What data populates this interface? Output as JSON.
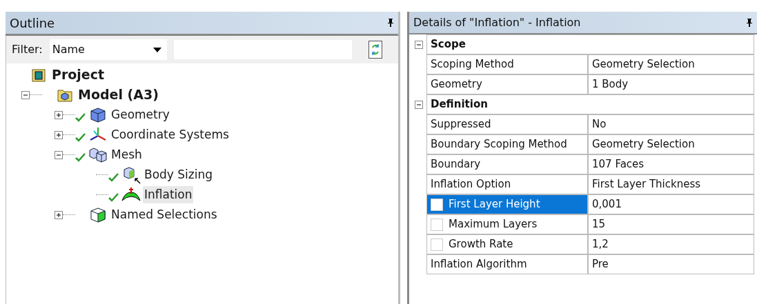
{
  "outline": {
    "title": "Outline",
    "filter": {
      "label": "Filter:",
      "value": "Name"
    },
    "tree": [
      {
        "label": "Project",
        "kind": "project",
        "children": [
          {
            "label": "Model (A3)",
            "kind": "model",
            "expanded": true,
            "children": [
              {
                "label": "Geometry",
                "kind": "geometry",
                "expanded": false,
                "solved": true,
                "selected": false
              },
              {
                "label": "Coordinate Systems",
                "kind": "axes",
                "expanded": false,
                "solved": true,
                "selected": false
              },
              {
                "label": "Mesh",
                "kind": "mesh",
                "expanded": true,
                "solved": true,
                "selected": false,
                "children": [
                  {
                    "label": "Body Sizing",
                    "kind": "sizing",
                    "solved": true,
                    "selected": false
                  },
                  {
                    "label": "Inflation",
                    "kind": "inflation",
                    "solved": true,
                    "selected": true
                  }
                ]
              },
              {
                "label": "Named Selections",
                "kind": "named",
                "expanded": false,
                "solved": false,
                "selected": false
              }
            ]
          }
        ]
      }
    ]
  },
  "details": {
    "title": "Details of \"Inflation\" - Inflation",
    "groups": [
      {
        "label": "Scope",
        "expanded": true,
        "rows": [
          {
            "label": "Scoping Method",
            "value": "Geometry Selection",
            "selected": false
          },
          {
            "label": "Geometry",
            "value": "1 Body",
            "selected": false
          }
        ]
      },
      {
        "label": "Definition",
        "expanded": true,
        "rows": [
          {
            "label": "Suppressed",
            "value": "No",
            "selected": false
          },
          {
            "label": "Boundary Scoping Method",
            "value": "Geometry Selection",
            "selected": false
          },
          {
            "label": "Boundary",
            "value": "107 Faces",
            "selected": false
          },
          {
            "label": "Inflation Option",
            "value": "First Layer Thickness",
            "selected": false
          },
          {
            "label": "First Layer Height",
            "value": "0,001",
            "selected": true,
            "checked": false
          },
          {
            "label": "Maximum Layers",
            "value": "15",
            "selected": false,
            "checked": false
          },
          {
            "label": "Growth Rate",
            "value": "1,2",
            "selected": false,
            "checked": false
          },
          {
            "label": "Inflation Algorithm",
            "value": "Pre",
            "selected": false
          }
        ]
      }
    ]
  }
}
